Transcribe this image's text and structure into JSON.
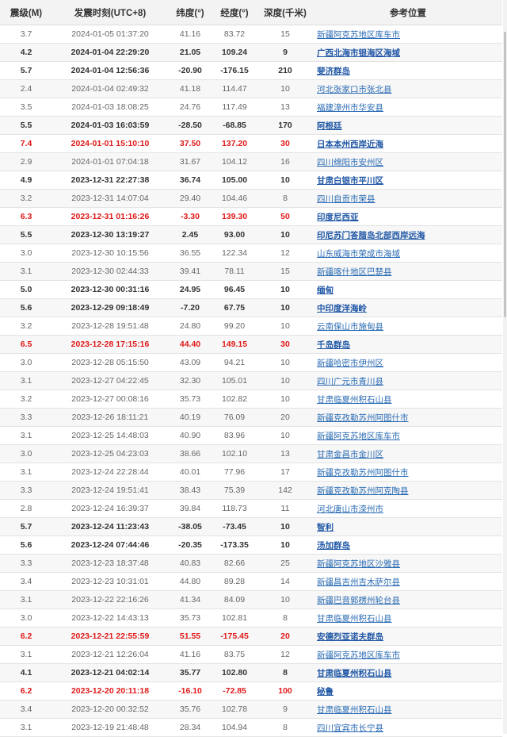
{
  "headers": {
    "magnitude": "震级(M)",
    "time": "发震时刻(UTC+8)",
    "latitude": "纬度(°)",
    "longitude": "经度(°)",
    "depth": "深度(千米)",
    "location": "参考位置"
  },
  "rows": [
    {
      "mag": "3.7",
      "time": "2024-01-05 01:37:20",
      "lat": "41.16",
      "lon": "83.72",
      "depth": "15",
      "loc": "新疆阿克苏地区库车市",
      "style": "normal"
    },
    {
      "mag": "4.2",
      "time": "2024-01-04 22:29:20",
      "lat": "21.05",
      "lon": "109.24",
      "depth": "9",
      "loc": "广西北海市银海区海域",
      "style": "bold"
    },
    {
      "mag": "5.7",
      "time": "2024-01-04 12:56:36",
      "lat": "-20.90",
      "lon": "-176.15",
      "depth": "210",
      "loc": "斐济群岛",
      "style": "bold"
    },
    {
      "mag": "2.4",
      "time": "2024-01-04 02:49:32",
      "lat": "41.18",
      "lon": "114.47",
      "depth": "10",
      "loc": "河北张家口市张北县",
      "style": "normal"
    },
    {
      "mag": "3.5",
      "time": "2024-01-03 18:08:25",
      "lat": "24.76",
      "lon": "117.49",
      "depth": "13",
      "loc": "福建漳州市华安县",
      "style": "normal"
    },
    {
      "mag": "5.5",
      "time": "2024-01-03 16:03:59",
      "lat": "-28.50",
      "lon": "-68.85",
      "depth": "170",
      "loc": "阿根廷",
      "style": "bold"
    },
    {
      "mag": "7.4",
      "time": "2024-01-01 15:10:10",
      "lat": "37.50",
      "lon": "137.20",
      "depth": "30",
      "loc": "日本本州西岸近海",
      "style": "red"
    },
    {
      "mag": "2.9",
      "time": "2024-01-01 07:04:18",
      "lat": "31.67",
      "lon": "104.12",
      "depth": "16",
      "loc": "四川绵阳市安州区",
      "style": "normal"
    },
    {
      "mag": "4.9",
      "time": "2023-12-31 22:27:38",
      "lat": "36.74",
      "lon": "105.00",
      "depth": "10",
      "loc": "甘肃白银市平川区",
      "style": "bold"
    },
    {
      "mag": "3.2",
      "time": "2023-12-31 14:07:04",
      "lat": "29.40",
      "lon": "104.46",
      "depth": "8",
      "loc": "四川自贡市荣县",
      "style": "normal"
    },
    {
      "mag": "6.3",
      "time": "2023-12-31 01:16:26",
      "lat": "-3.30",
      "lon": "139.30",
      "depth": "50",
      "loc": "印度尼西亚",
      "style": "red"
    },
    {
      "mag": "5.5",
      "time": "2023-12-30 13:19:27",
      "lat": "2.45",
      "lon": "93.00",
      "depth": "10",
      "loc": "印尼苏门答腊岛北部西岸远海",
      "style": "bold"
    },
    {
      "mag": "3.0",
      "time": "2023-12-30 10:15:56",
      "lat": "36.55",
      "lon": "122.34",
      "depth": "12",
      "loc": "山东威海市荣成市海域",
      "style": "normal"
    },
    {
      "mag": "3.1",
      "time": "2023-12-30 02:44:33",
      "lat": "39.41",
      "lon": "78.11",
      "depth": "15",
      "loc": "新疆喀什地区巴楚县",
      "style": "normal"
    },
    {
      "mag": "5.0",
      "time": "2023-12-30 00:31:16",
      "lat": "24.95",
      "lon": "96.45",
      "depth": "10",
      "loc": "缅甸",
      "style": "bold"
    },
    {
      "mag": "5.6",
      "time": "2023-12-29 09:18:49",
      "lat": "-7.20",
      "lon": "67.75",
      "depth": "10",
      "loc": "中印度洋海岭",
      "style": "bold"
    },
    {
      "mag": "3.2",
      "time": "2023-12-28 19:51:48",
      "lat": "24.80",
      "lon": "99.20",
      "depth": "10",
      "loc": "云南保山市施甸县",
      "style": "normal"
    },
    {
      "mag": "6.5",
      "time": "2023-12-28 17:15:16",
      "lat": "44.40",
      "lon": "149.15",
      "depth": "30",
      "loc": "千岛群岛",
      "style": "red"
    },
    {
      "mag": "3.0",
      "time": "2023-12-28 05:15:50",
      "lat": "43.09",
      "lon": "94.21",
      "depth": "10",
      "loc": "新疆哈密市伊州区",
      "style": "normal"
    },
    {
      "mag": "3.1",
      "time": "2023-12-27 04:22:45",
      "lat": "32.30",
      "lon": "105.01",
      "depth": "10",
      "loc": "四川广元市青川县",
      "style": "normal"
    },
    {
      "mag": "3.2",
      "time": "2023-12-27 00:08:16",
      "lat": "35.73",
      "lon": "102.82",
      "depth": "10",
      "loc": "甘肃临夏州积石山县",
      "style": "normal"
    },
    {
      "mag": "3.3",
      "time": "2023-12-26 18:11:21",
      "lat": "40.19",
      "lon": "76.09",
      "depth": "20",
      "loc": "新疆克孜勒苏州阿图什市",
      "style": "normal"
    },
    {
      "mag": "3.1",
      "time": "2023-12-25 14:48:03",
      "lat": "40.90",
      "lon": "83.96",
      "depth": "10",
      "loc": "新疆阿克苏地区库车市",
      "style": "normal"
    },
    {
      "mag": "3.0",
      "time": "2023-12-25 04:23:03",
      "lat": "38.66",
      "lon": "102.10",
      "depth": "13",
      "loc": "甘肃金昌市金川区",
      "style": "normal"
    },
    {
      "mag": "3.1",
      "time": "2023-12-24 22:28:44",
      "lat": "40.01",
      "lon": "77.96",
      "depth": "17",
      "loc": "新疆克孜勒苏州阿图什市",
      "style": "normal"
    },
    {
      "mag": "3.3",
      "time": "2023-12-24 19:51:41",
      "lat": "38.43",
      "lon": "75.39",
      "depth": "142",
      "loc": "新疆克孜勒苏州阿克陶县",
      "style": "normal"
    },
    {
      "mag": "2.8",
      "time": "2023-12-24 16:39:37",
      "lat": "39.84",
      "lon": "118.73",
      "depth": "11",
      "loc": "河北唐山市滦州市",
      "style": "normal"
    },
    {
      "mag": "5.7",
      "time": "2023-12-24 11:23:43",
      "lat": "-38.05",
      "lon": "-73.45",
      "depth": "10",
      "loc": "智利",
      "style": "bold"
    },
    {
      "mag": "5.6",
      "time": "2023-12-24 07:44:46",
      "lat": "-20.35",
      "lon": "-173.35",
      "depth": "10",
      "loc": "汤加群岛",
      "style": "bold"
    },
    {
      "mag": "3.3",
      "time": "2023-12-23 18:37:48",
      "lat": "40.83",
      "lon": "82.66",
      "depth": "25",
      "loc": "新疆阿克苏地区沙雅县",
      "style": "normal"
    },
    {
      "mag": "3.4",
      "time": "2023-12-23 10:31:01",
      "lat": "44.80",
      "lon": "89.28",
      "depth": "14",
      "loc": "新疆昌吉州吉木萨尔县",
      "style": "normal"
    },
    {
      "mag": "3.1",
      "time": "2023-12-22 22:16:26",
      "lat": "41.34",
      "lon": "84.09",
      "depth": "10",
      "loc": "新疆巴音郭楞州轮台县",
      "style": "normal"
    },
    {
      "mag": "3.0",
      "time": "2023-12-22 14:43:13",
      "lat": "35.73",
      "lon": "102.81",
      "depth": "8",
      "loc": "甘肃临夏州积石山县",
      "style": "normal"
    },
    {
      "mag": "6.2",
      "time": "2023-12-21 22:55:59",
      "lat": "51.55",
      "lon": "-175.45",
      "depth": "20",
      "loc": "安德烈亚诺夫群岛",
      "style": "red"
    },
    {
      "mag": "3.1",
      "time": "2023-12-21 12:26:04",
      "lat": "41.16",
      "lon": "83.75",
      "depth": "12",
      "loc": "新疆阿克苏地区库车市",
      "style": "normal"
    },
    {
      "mag": "4.1",
      "time": "2023-12-21 04:02:14",
      "lat": "35.77",
      "lon": "102.80",
      "depth": "8",
      "loc": "甘肃临夏州积石山县",
      "style": "bold"
    },
    {
      "mag": "6.2",
      "time": "2023-12-20 20:11:18",
      "lat": "-16.10",
      "lon": "-72.85",
      "depth": "100",
      "loc": "秘鲁",
      "style": "red"
    },
    {
      "mag": "3.4",
      "time": "2023-12-20 00:32:52",
      "lat": "35.76",
      "lon": "102.78",
      "depth": "9",
      "loc": "甘肃临夏州积石山县",
      "style": "normal"
    },
    {
      "mag": "3.1",
      "time": "2023-12-19 21:48:48",
      "lat": "28.34",
      "lon": "104.94",
      "depth": "8",
      "loc": "四川宜宾市长宁县",
      "style": "normal"
    }
  ]
}
